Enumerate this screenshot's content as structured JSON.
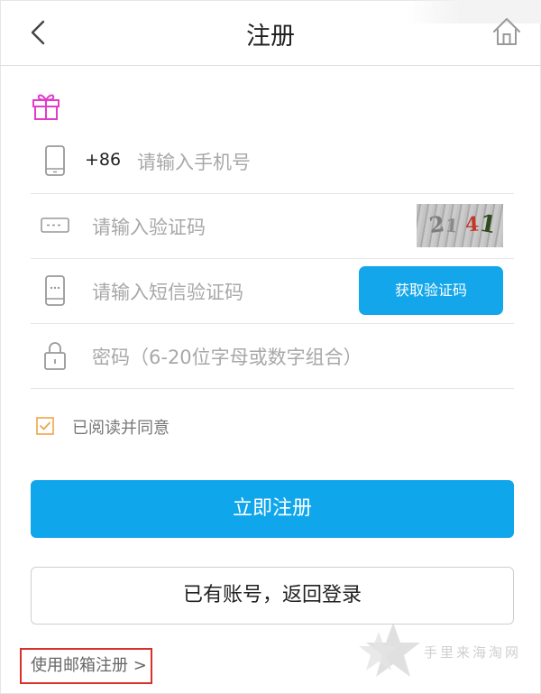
{
  "header": {
    "title": "注册",
    "back_icon": "chevron-left-icon",
    "home_icon": "home-icon"
  },
  "form": {
    "gift_icon": "gift-icon",
    "phone": {
      "icon": "phone-icon",
      "country_code": "+86",
      "placeholder": "请输入手机号"
    },
    "captcha": {
      "icon": "captcha-icon",
      "placeholder": "请输入验证码",
      "image_chars": [
        "2",
        "1",
        "4",
        "1"
      ]
    },
    "sms": {
      "icon": "sms-phone-icon",
      "placeholder": "请输入短信验证码",
      "button_label": "获取验证码"
    },
    "password": {
      "icon": "lock-icon",
      "placeholder": "密码（6-20位字母或数字组合）"
    },
    "agreement": {
      "checked": true,
      "label": "已阅读并同意"
    }
  },
  "actions": {
    "register_label": "立即注册",
    "login_label": "已有账号，返回登录",
    "email_register_label": "使用邮箱注册 >"
  },
  "watermark": {
    "text": "手里来海淘网"
  },
  "colors": {
    "primary": "#0fa6ec",
    "gift": "#e23cc8",
    "checkbox": "#f0a447",
    "highlight_border": "#d9302c"
  }
}
